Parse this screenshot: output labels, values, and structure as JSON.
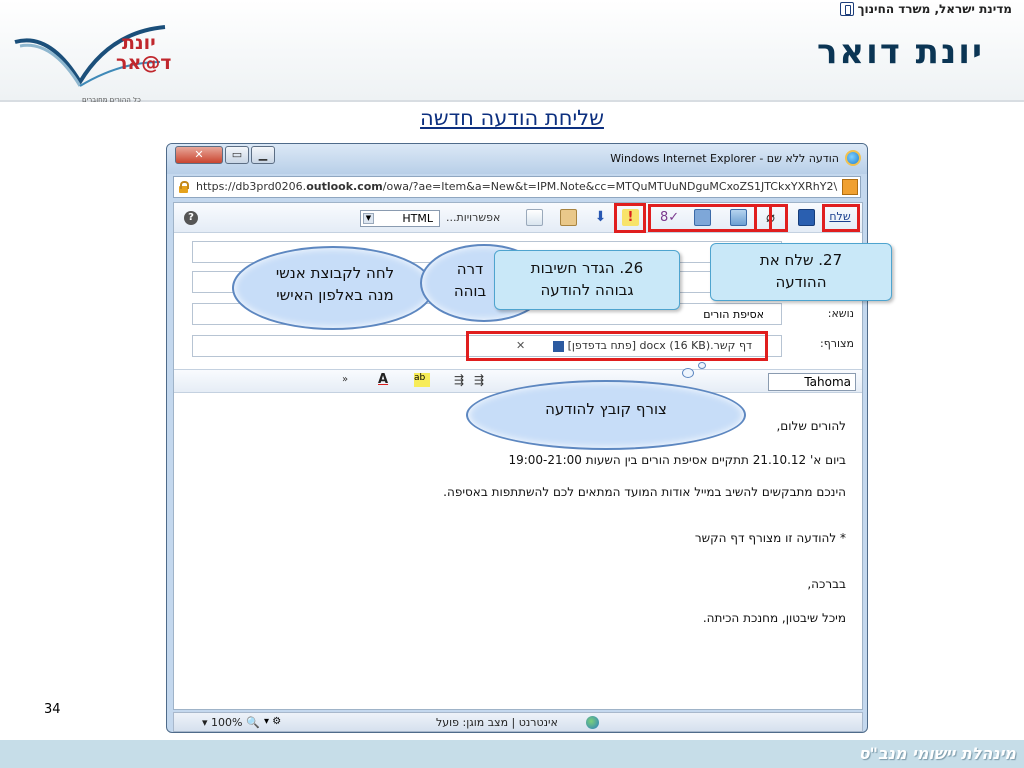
{
  "header": {
    "ministry": "מדינת ישראל, משרד החינוך",
    "brand": "יונת דואר",
    "logo_line1": "יונת",
    "logo_line2": "ד@אר",
    "logo_sub": "כל ההורים מחוברים"
  },
  "slide": {
    "title": "שליחת הודעה חדשה",
    "page_number": "34",
    "footer": "מינהלת יישומי מנב\"ס"
  },
  "browser": {
    "window_title": "הודעה ללא שם - Windows Internet Explorer",
    "address_prefix": "https://db3prd0206.",
    "address_domain": "outlook.com",
    "address_suffix": "/owa/?ae=Item&a=New&t=IPM.Note&cc=MTQuMTUuNDguMCxoZS1JTCkxYXRhY2\\"
  },
  "compose": {
    "send_label": "שלח",
    "options_label": "אפשרויות...",
    "format_value": "HTML",
    "subject_label": "נושא:",
    "subject_value": "אסיפת הורים",
    "attach_label": "מצורף:",
    "attachment": "דף קשר.docx (16 KB) [פתח בדפדפן]",
    "font_value": "Tahoma",
    "body": [
      "להורים שלום,",
      "ביום א' 21.10.12 תתקיים אסיפת הורים בין השעות 19:00-21:00",
      "הינכם מתבקשים להשיב במייל אודות המועד המתאים לכם להשתתפות באסיפה.",
      "* להודעה זו מצורף דף הקשר",
      "בברכה,",
      "מיכל שיבטון, מחנכת הכיתה."
    ]
  },
  "statusbar": {
    "zoom": "100%",
    "status": "אינטרנט | מצב מוגן: פועל"
  },
  "annotations": {
    "cloud_group_line1": "לחה לקבוצת אנשי",
    "cloud_group_line2": "מנה באלפון האישי",
    "cloud_priority_partial_1": "דרה",
    "cloud_priority_partial_2": "בוהה",
    "callout_26_line1": "26. הגדר חשיבות",
    "callout_26_line2": "גבוהה להודעה",
    "callout_27_line1": "27. שלח את",
    "callout_27_line2": "ההודעה",
    "cloud_attach": "צורף קובץ להודעה"
  },
  "colors": {
    "highlight": "#e01e1e",
    "brand": "#0b3554",
    "title": "#0c2f7f"
  }
}
